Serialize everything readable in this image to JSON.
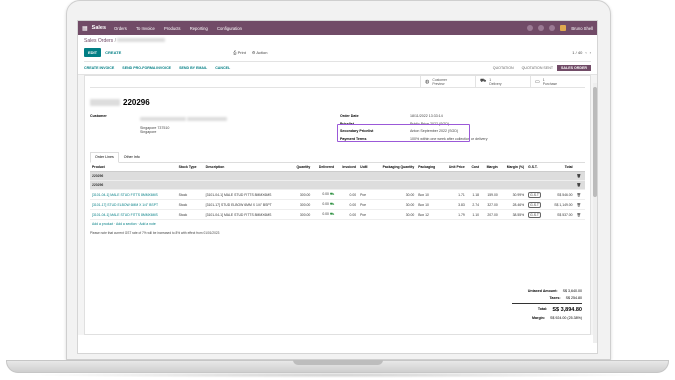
{
  "topbar": {
    "app_name": "Sales",
    "menu": [
      "Orders",
      "To Invoice",
      "Products",
      "Reporting",
      "Configuration"
    ],
    "user": "Bruno Shell",
    "badge_count": "4"
  },
  "breadcrumb": {
    "root": "Sales Orders",
    "sep": "/"
  },
  "control": {
    "edit_label": "EDIT",
    "create_label": "CREATE",
    "print_label": "Print",
    "action_label": "Action",
    "pager": "1 / 40"
  },
  "status_actions": [
    "CREATE INVOICE",
    "SEND PRO-FORMA INVOICE",
    "SEND BY EMAIL",
    "CANCEL"
  ],
  "status_steps": [
    "QUOTATION",
    "QUOTATION SENT",
    "SALES ORDER"
  ],
  "active_step": "SALES ORDER",
  "smart_buttons": [
    {
      "icon": "globe-icon",
      "line1": "Customer",
      "line2": "Preview"
    },
    {
      "icon": "truck-icon",
      "line1": "1",
      "line2": "Delivery"
    },
    {
      "icon": "credit-card-icon",
      "line1": "1",
      "line2": "Purchase"
    }
  ],
  "order": {
    "number": "220296",
    "customer_label": "Customer",
    "customer_city": "Singapore 737510",
    "customer_country": "Singapore",
    "order_date_label": "Order Date",
    "order_date": "18/11/2022 13:33:14",
    "pricelist_label": "Pricelist",
    "pricelist": "Public Price 2022 (SGD)",
    "secondary_label": "Secondary Pricelist",
    "secondary": "Anton September 2022 (SGD)",
    "payment_label": "Payment Terms",
    "payment": "100% within one week after collection or delivery"
  },
  "tabs": [
    "Order Lines",
    "Other Info"
  ],
  "table": {
    "headers": [
      "Product",
      "Stock Type",
      "Description",
      "Quantity",
      "Delivered",
      "Invoiced",
      "UoM",
      "Packaging Quantity",
      "Packaging",
      "Unit Price",
      "Cost",
      "Margin",
      "Margin (%)",
      "G.S.T.",
      "Total"
    ],
    "sections": [
      "220296",
      "220296"
    ],
    "rows": [
      {
        "product": "[3101-04-1] MALE STUD FITTS 8MMX6MS",
        "stock": "Stock",
        "desc": "[3101-04-1] MALE STUD FITTS 8MMX6MS",
        "qty": "300.00",
        "del": "0.00",
        "inv": "0.00",
        "uom": "Pce",
        "pq": "30.00",
        "pack": "Box 10",
        "price": "1.71",
        "cost": "1.18",
        "margin": "159.00",
        "mpct": "30.99%",
        "gst": "G.S.T",
        "total": "S$ 546.00"
      },
      {
        "product": "[3101-17] STUD ELBOW 6MM X 1/4\" BSPT",
        "stock": "Stock",
        "desc": "[3101-17] STUD ELBOW 6MM X 1/4\" BSPT",
        "qty": "300.00",
        "del": "0.00",
        "inv": "0.00",
        "uom": "Pce",
        "pq": "30.00",
        "pack": "Box 10",
        "price": "3.83",
        "cost": "2.74",
        "margin": "327.00",
        "mpct": "28.46%",
        "gst": "G.S.T",
        "total": "S$ 1,149.00"
      },
      {
        "product": "[3101-04-1] MALE STUD FITTS 8MMX6MS",
        "stock": "Stock",
        "desc": "[3101-04-1] MALE STUD FITTS 8MMX6MS",
        "qty": "300.00",
        "del": "0.00",
        "inv": "0.00",
        "uom": "Pce",
        "pq": "30.00",
        "pack": "Box 12",
        "price": "1.79",
        "cost": "1.10",
        "margin": "207.00",
        "mpct": "38.55%",
        "gst": "G.S.T",
        "total": "S$ 537.00"
      }
    ],
    "add_links": [
      "Add a product",
      "Add a section",
      "Add a note"
    ]
  },
  "note": "Please note that current GST rate of 7% will be increased to 8% with effect from 01/01/2023",
  "totals": {
    "untaxed_label": "Untaxed Amount:",
    "untaxed": "S$ 3,640.00",
    "taxes_label": "Taxes:",
    "taxes": "S$ 254.80",
    "total_label": "Total:",
    "total": "S$ 3,894.80",
    "margin_label": "Margin:",
    "margin": "S$ 924.00 (25.38%)"
  },
  "colors": {
    "brand": "#714b67",
    "accent": "#017e84",
    "highlight": "#9b59d8"
  }
}
